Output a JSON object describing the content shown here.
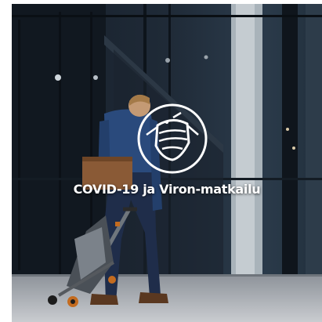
{
  "card": {
    "title": "COVID-19 ja Viron-matkailu",
    "icon": "face-mask-icon",
    "link_color": "#ffffff"
  }
}
